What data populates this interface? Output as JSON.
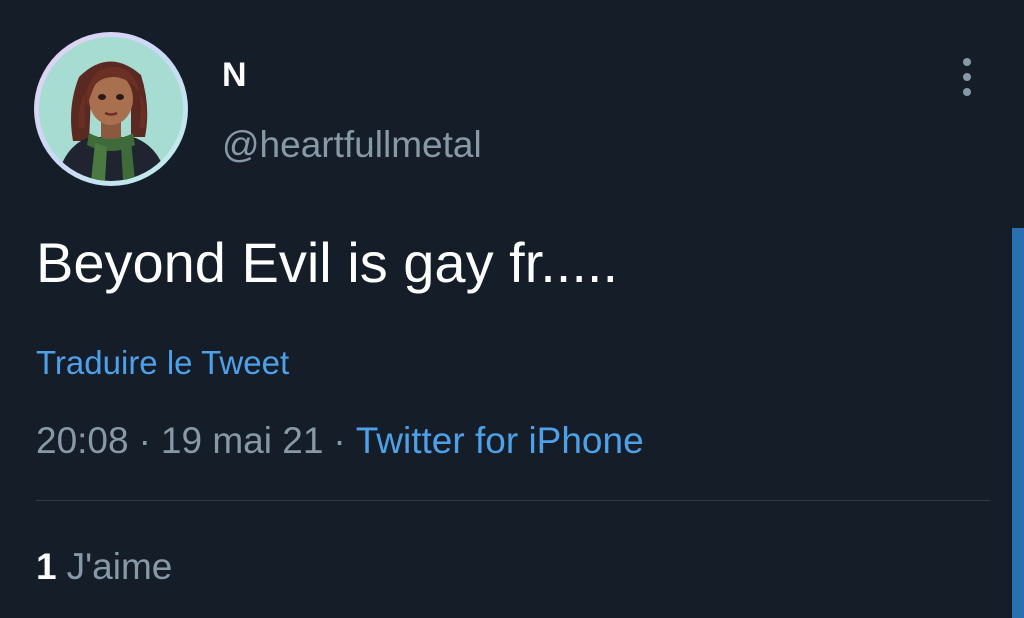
{
  "author": {
    "display_name": "N",
    "handle": "@heartfullmetal"
  },
  "tweet": {
    "text": "Beyond Evil is gay fr.....",
    "translate_label": "Traduire le Tweet",
    "time": "20:08",
    "date": "19 mai 21",
    "separator": "·",
    "source": "Twitter for iPhone"
  },
  "stats": {
    "likes_count": "1",
    "likes_label": "J'aime"
  },
  "icons": {
    "more": "more-vertical-icon"
  },
  "colors": {
    "background": "#151d28",
    "text_primary": "#ffffff",
    "text_secondary": "#8899a6",
    "link": "#4ea0e8",
    "divider": "#2f3b48",
    "scroll_accent": "#2a6fb0"
  }
}
